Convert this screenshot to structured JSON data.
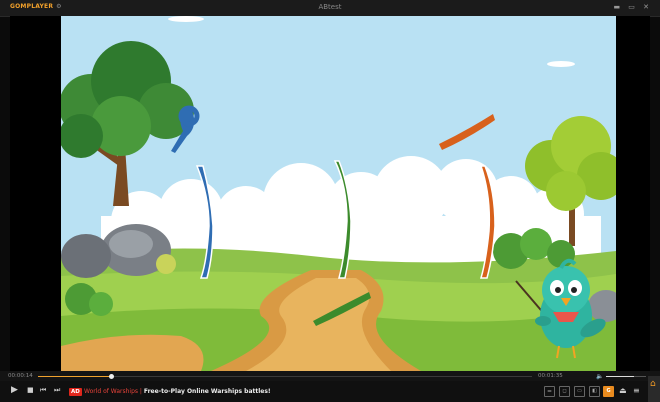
{
  "app": {
    "logo": "GOMPLAYER",
    "window_title": "ABtest",
    "window_controls": "▬ ▭ ✕"
  },
  "seek": {
    "current_time": "00:00:14",
    "total_time": "00:01:35",
    "progress": 0.147,
    "volume": 0.7
  },
  "controls": {
    "ad_badge": "AD",
    "ad_brand": "World of Warships",
    "ad_separator": " | ",
    "ad_text": "Free-to-Play Online Warships battles!"
  },
  "colors": {
    "accent": "#f0a22e",
    "ad_red": "#e0261c",
    "sky": "#b7e0f3",
    "blue_stroke": "#2f6db3",
    "green_stroke": "#3c8b2c",
    "orange_stroke": "#d8611c"
  },
  "icons": {
    "play": "play-icon",
    "stop": "stop-icon",
    "prev": "prev-icon",
    "next": "next-icon",
    "playlist": "playlist-icon",
    "eject": "eject-icon"
  }
}
